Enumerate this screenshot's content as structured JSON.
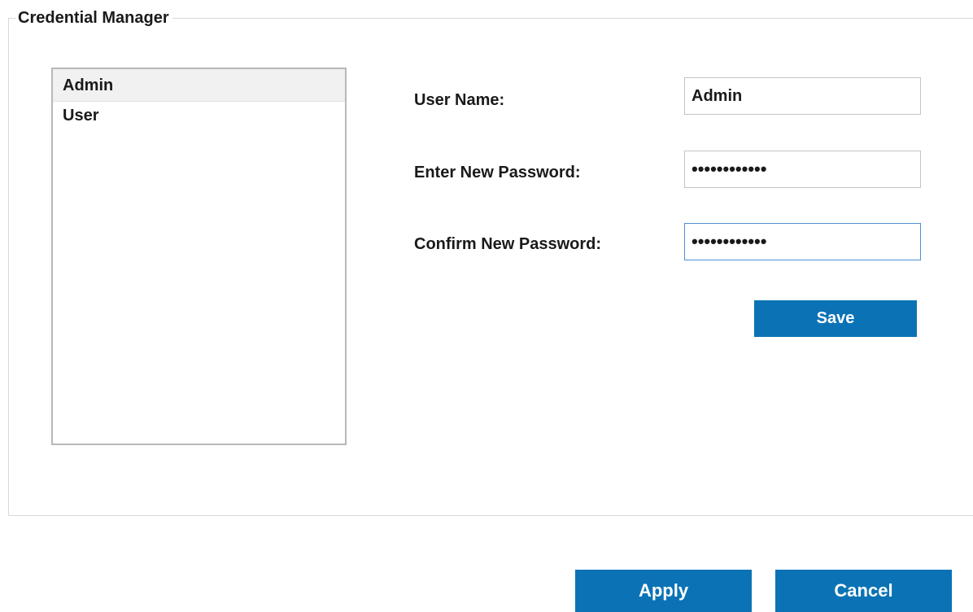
{
  "group": {
    "title": "Credential Manager"
  },
  "user_list": {
    "items": [
      {
        "label": "Admin",
        "selected": true
      },
      {
        "label": "User",
        "selected": false
      }
    ]
  },
  "form": {
    "username_label": "User Name:",
    "username_value": "Admin",
    "new_password_label": "Enter New Password:",
    "new_password_value": "••••••••••••",
    "confirm_password_label": "Confirm New Password:",
    "confirm_password_value": "••••••••••••"
  },
  "buttons": {
    "save_label": "Save",
    "apply_label": "Apply",
    "cancel_label": "Cancel"
  },
  "colors": {
    "button_bg": "#0b73b5",
    "focus_border": "#4d8fd6",
    "selected_row_bg": "#f1f1f1"
  }
}
